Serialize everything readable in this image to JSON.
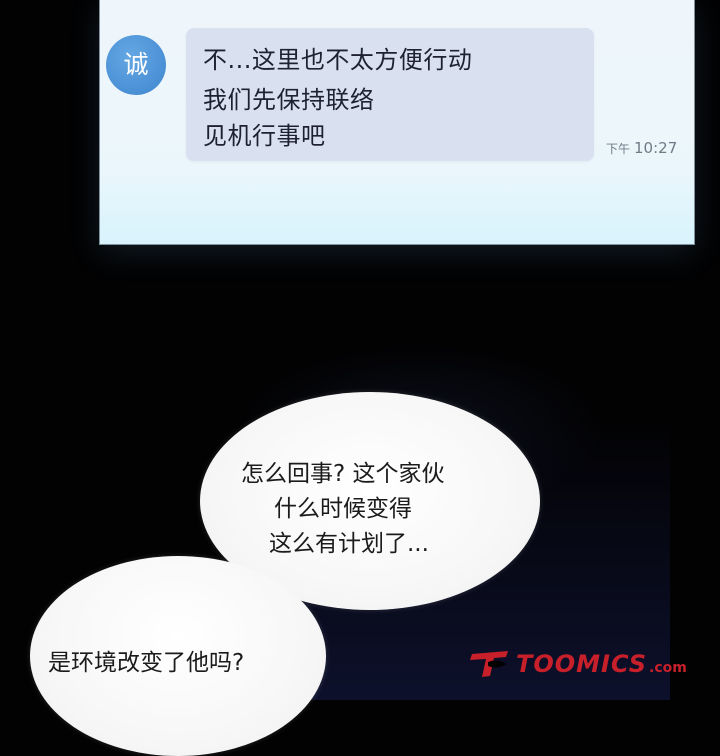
{
  "chat": {
    "avatar_label": "诚",
    "message_lines": [
      "不...这里也不太方便行动",
      "我们先保持联络",
      "见机行事吧"
    ],
    "timestamp_period": "下午",
    "timestamp_time": "10:27",
    "colors": {
      "avatar": "#4a91d8",
      "bubble": "#d9e1f1",
      "screen": "#eef5fb"
    }
  },
  "speech_bubbles": [
    {
      "lines": [
        "怎么回事? 这个家伙",
        "什么时候变得",
        "这么有计划了..."
      ]
    },
    {
      "lines": [
        "是环境改变了他吗?"
      ]
    }
  ],
  "watermark": {
    "brand": "TOOMICS",
    "suffix": ".com",
    "color": "#c8202a",
    "icon": "toomics-logo-icon"
  }
}
